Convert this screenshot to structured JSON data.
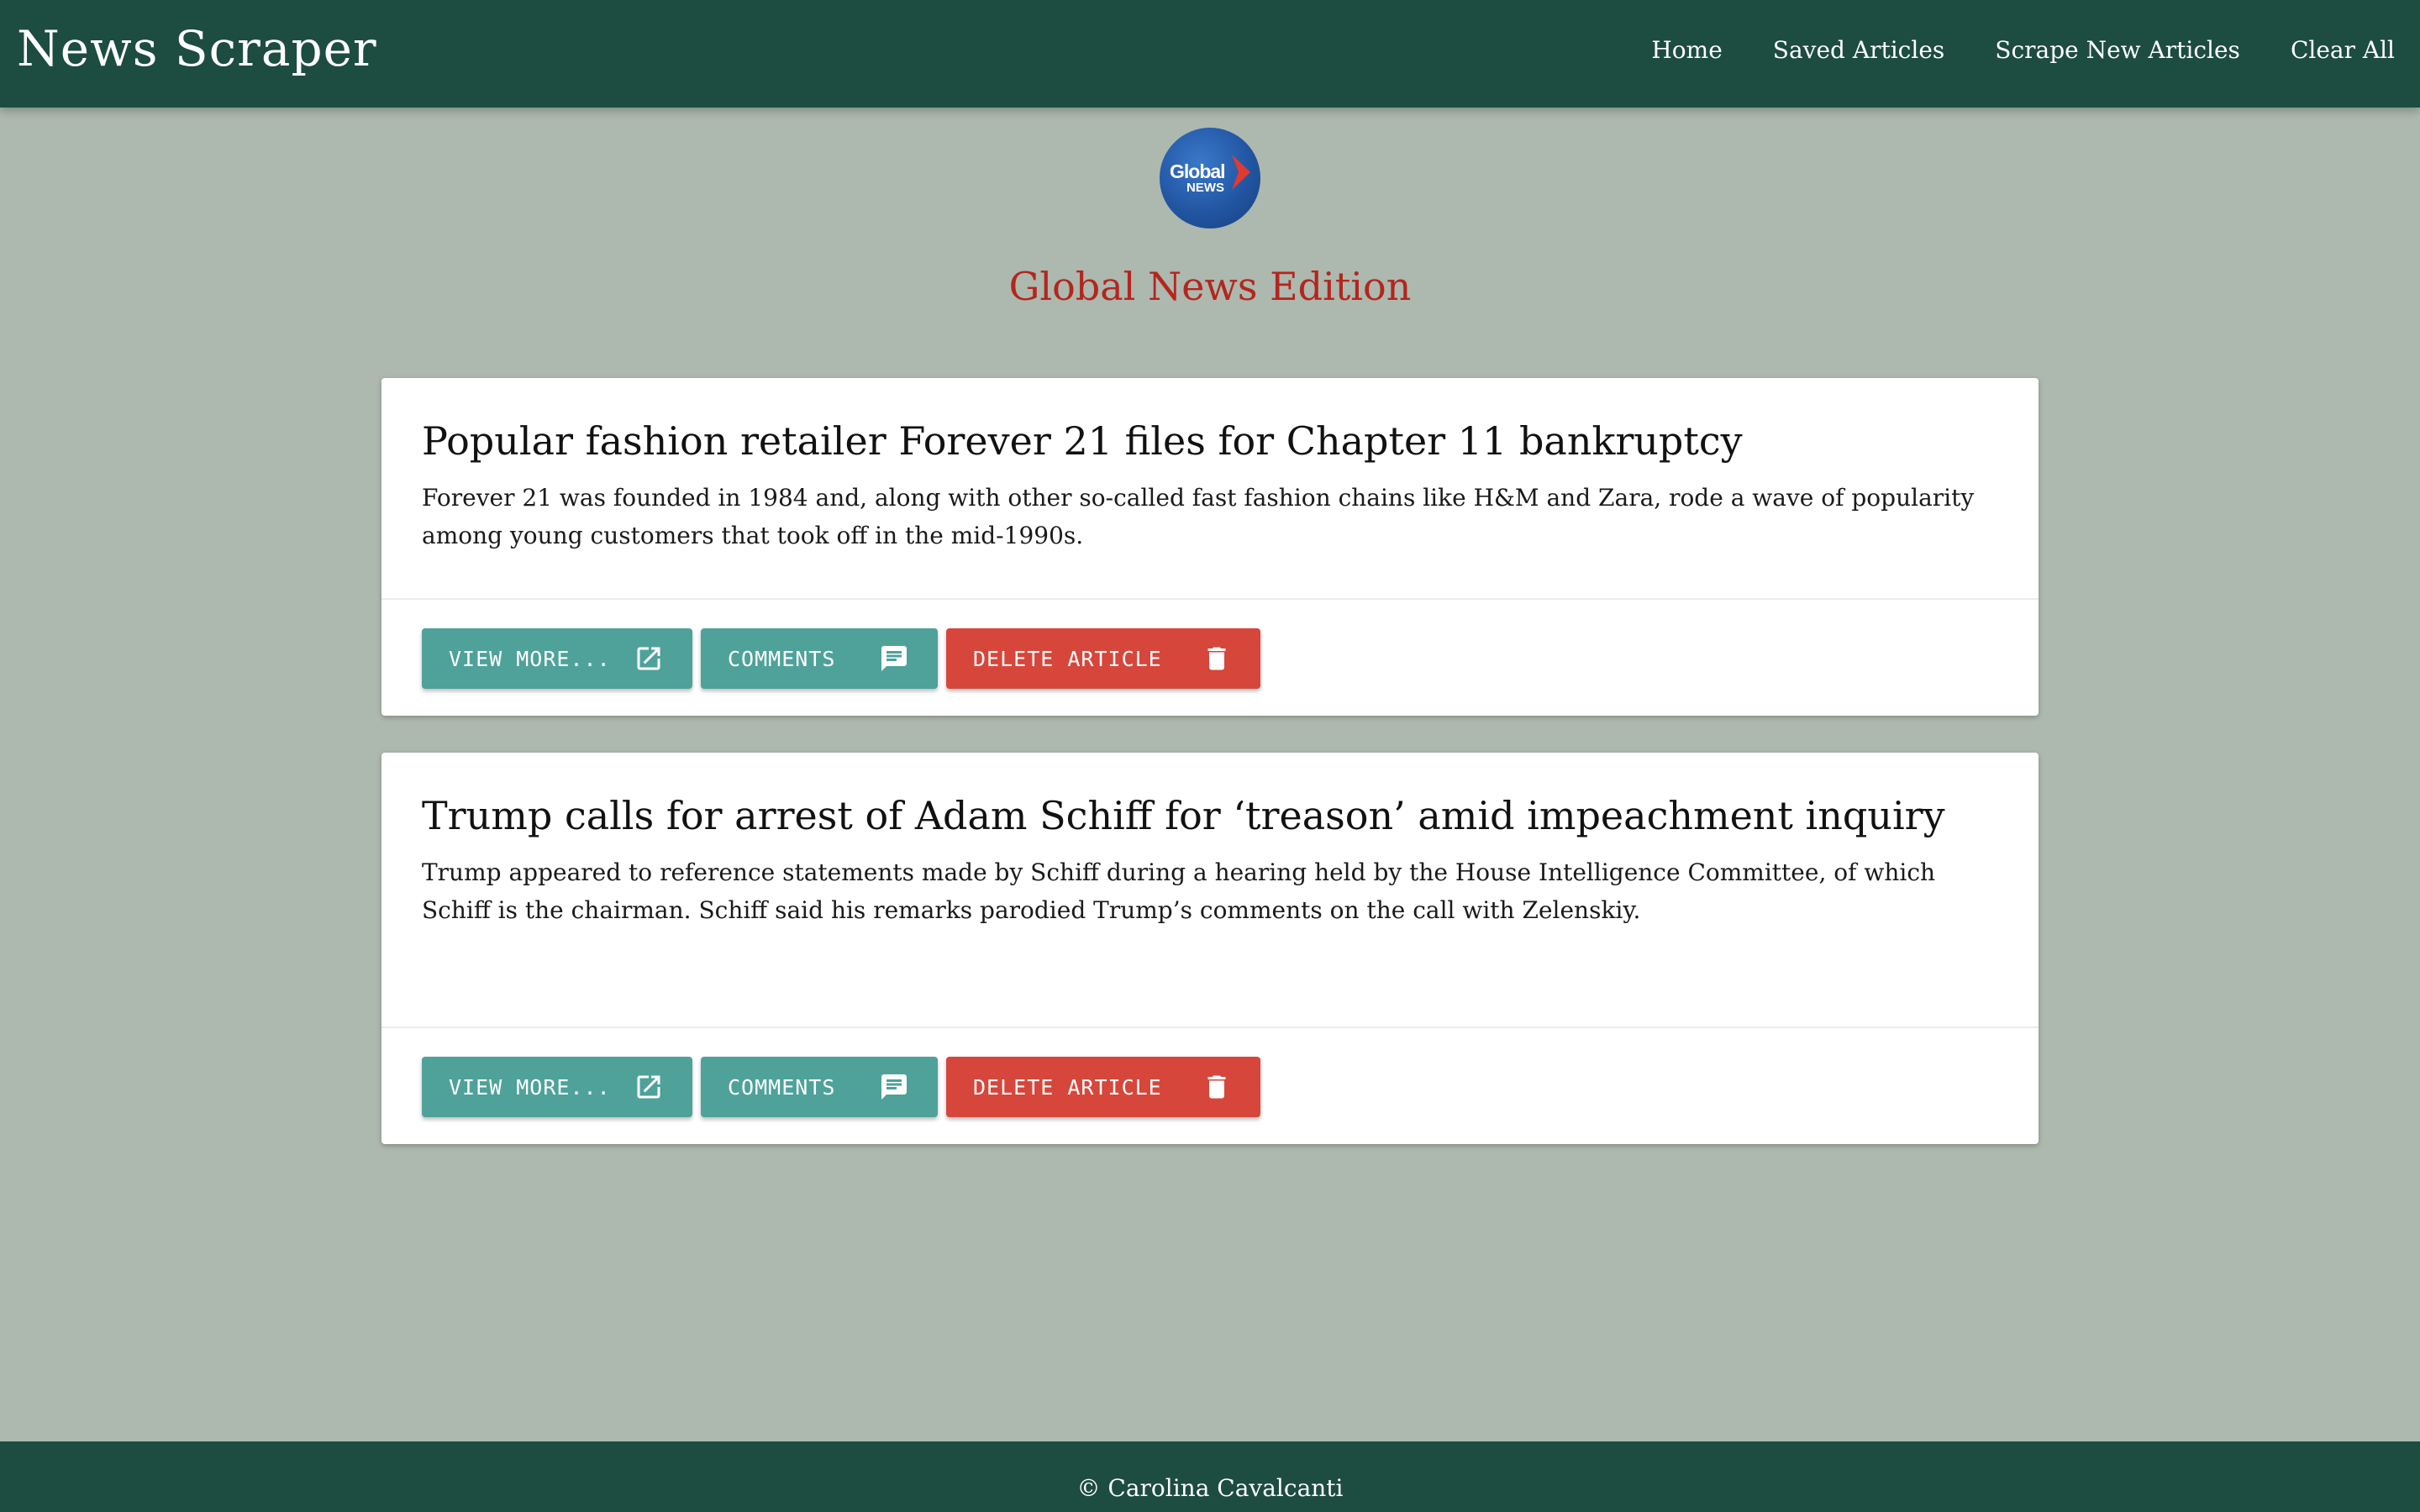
{
  "navbar": {
    "brand": "News Scraper",
    "links": [
      "Home",
      "Saved Articles",
      "Scrape New Articles",
      "Clear All"
    ]
  },
  "header": {
    "logo": {
      "line1": "Global",
      "line2": "NEWS"
    },
    "edition_title": "Global News Edition"
  },
  "articles": [
    {
      "title": "Popular fashion retailer Forever 21 files for Chapter 11 bankruptcy",
      "summary": "Forever 21 was founded in 1984 and, along with other so-called fast fashion chains like H&M and Zara, rode a wave of popularity among young customers that took off in the mid-1990s.",
      "view_label": "VIEW MORE...",
      "comments_label": "COMMENTS",
      "delete_label": "DELETE ARTICLE"
    },
    {
      "title": "Trump calls for arrest of Adam Schiff for ‘treason’ amid impeachment inquiry",
      "summary": "Trump appeared to reference statements made by Schiff during a hearing held by the House Intelligence Committee, of which Schiff is the chairman. Schiff said his remarks parodied Trump’s comments on the call with Zelenskiy.",
      "view_label": "VIEW MORE...",
      "comments_label": "COMMENTS",
      "delete_label": "DELETE ARTICLE"
    }
  ],
  "footer": {
    "text": "© Carolina Cavalcanti"
  },
  "colors": {
    "navbar": "#1d4c41",
    "background": "#adb8ae",
    "edition_title": "#b3261e",
    "teal_button": "#4ea29a",
    "red_button": "#d7463b"
  },
  "icons": {
    "view_more": "open-in-new-icon",
    "comments": "comment-icon",
    "delete": "trash-icon"
  }
}
